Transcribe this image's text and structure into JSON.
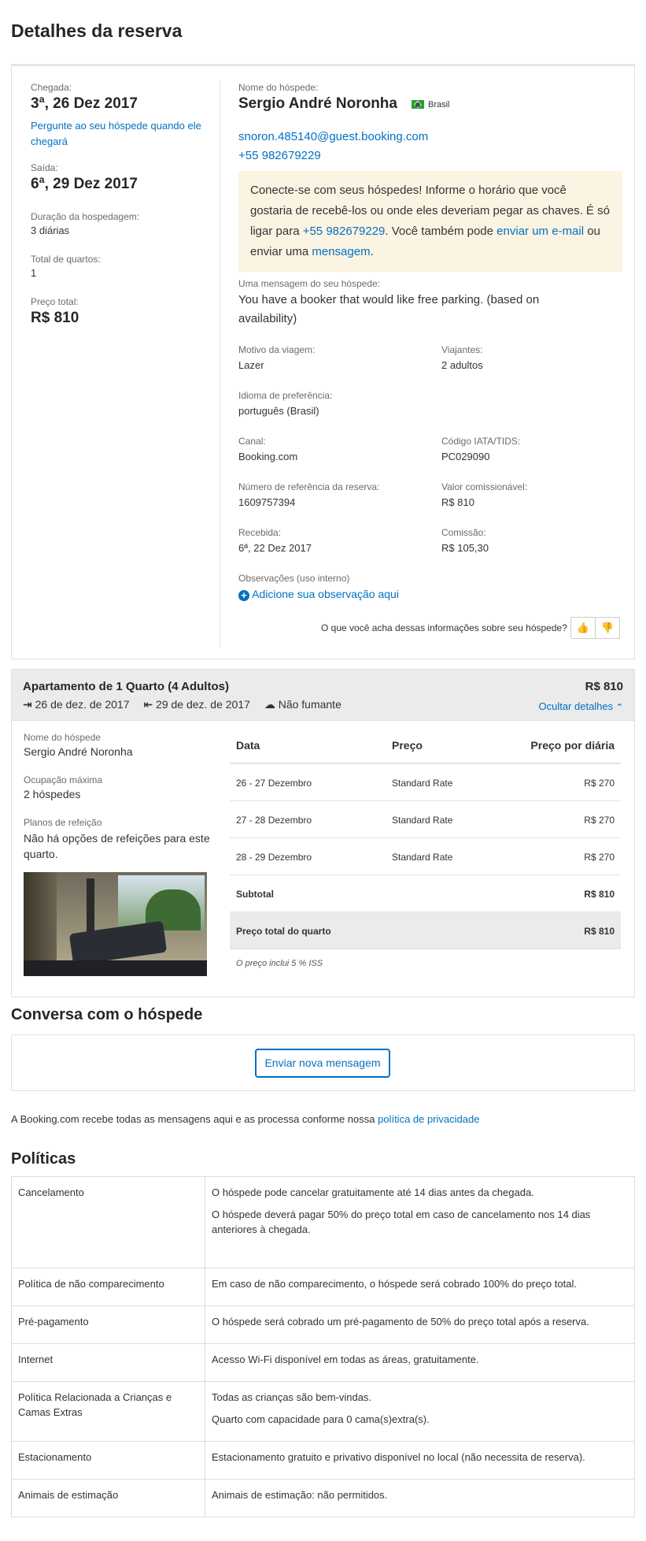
{
  "page_title": "Detalhes da reserva",
  "left": {
    "checkin_label": "Chegada:",
    "checkin_value": "3ª, 26 Dez 2017",
    "ask_link": "Pergunte ao seu hóspede quando ele chegará",
    "checkout_label": "Saída:",
    "checkout_value": "6ª, 29 Dez 2017",
    "stay_label": "Duração da hospedagem:",
    "stay_value": "3 diárias",
    "rooms_label": "Total de quartos:",
    "rooms_value": "1",
    "price_label": "Preço total:",
    "price_value": "R$ 810"
  },
  "guest": {
    "name_label": "Nome do hóspede:",
    "name": "Sergio André Noronha",
    "country": "Brasil",
    "email": "snoron.485140@guest.booking.com",
    "phone": "+55 982679229"
  },
  "notice": {
    "t1": "Conecte-se com seus hóspedes! Informe o horário que você gostaria de recebê-los ou onde eles deveriam pegar as chaves. É só ligar para ",
    "phone": "+55 982679229",
    "t2": ". Você também pode ",
    "email_link": "enviar um e-mail",
    "t3": " ou enviar uma ",
    "msg_link": "mensagem",
    "t4": "."
  },
  "message": {
    "label": "Uma mensagem do seu hóspede:",
    "text": "You have a booker that would like free parking. (based on availability)"
  },
  "details": {
    "motivo_label": "Motivo da viagem:",
    "motivo": "Lazer",
    "viajantes_label": "Viajantes:",
    "viajantes": "2 adultos",
    "idioma_label": "Idioma de preferência:",
    "idioma": "português (Brasil)",
    "canal_label": "Canal:",
    "canal": "Booking.com",
    "iata_label": "Código IATA/TIDS:",
    "iata": "PC029090",
    "ref_label": "Número de referência da reserva:",
    "ref": "1609757394",
    "valor_label": "Valor comissionável:",
    "valor": "R$ 810",
    "recebida_label": "Recebida:",
    "recebida": "6ª, 22 Dez 2017",
    "comissao_label": "Comissão:",
    "comissao": "R$ 105,30",
    "obs_label": "Observações (uso interno)",
    "obs_link": "Adicione sua observação aqui",
    "feedback": "O que você acha dessas informações sobre seu hóspede?"
  },
  "room": {
    "title": "Apartamento de 1 Quarto (4 Adultos)",
    "price": "R$ 810",
    "checkin": "26 de dez. de 2017",
    "checkout": "29 de dez. de 2017",
    "smoking": "Não fumante",
    "hide": "Ocultar detalhes",
    "guest_label": "Nome do hóspede",
    "guest": "Sergio André Noronha",
    "occ_label": "Ocupação máxima",
    "occ": "2 hóspedes",
    "meal_label": "Planos de refeição",
    "meal": "Não há opções de refeições para este quarto.",
    "table": {
      "h_date": "Data",
      "h_price": "Preço",
      "h_daily": "Preço por diária",
      "rows": [
        {
          "date": "26 - 27 Dezembro",
          "rate": "Standard Rate",
          "amount": "R$ 270"
        },
        {
          "date": "27 - 28 Dezembro",
          "rate": "Standard Rate",
          "amount": "R$ 270"
        },
        {
          "date": "28 - 29 Dezembro",
          "rate": "Standard Rate",
          "amount": "R$ 270"
        }
      ],
      "subtotal_label": "Subtotal",
      "subtotal": "R$ 810",
      "total_label": "Preço total do quarto",
      "total": "R$ 810",
      "note": "O preço inclui 5 % ISS"
    }
  },
  "conversation": {
    "title": "Conversa com o hóspede",
    "button": "Enviar nova mensagem",
    "privacy_text": "A Booking.com recebe todas as mensagens aqui e as processa conforme nossa ",
    "privacy_link": "política de privacidade"
  },
  "policies": {
    "title": "Políticas",
    "rows": [
      {
        "k": "Cancelamento",
        "v": [
          "O hóspede pode cancelar gratuitamente até 14 dias antes da chegada.",
          "O hóspede deverá pagar 50% do preço total em caso de cancelamento nos 14 dias anteriores à chegada."
        ]
      },
      {
        "k": "Política de não comparecimento",
        "v": [
          "Em caso de não comparecimento, o hóspede será cobrado 100% do preço total."
        ]
      },
      {
        "k": "Pré-pagamento",
        "v": [
          "O hóspede será cobrado um pré-pagamento de 50% do preço total após a reserva."
        ]
      },
      {
        "k": "Internet",
        "v": [
          "Acesso Wi-Fi disponível em todas as áreas, gratuitamente."
        ]
      },
      {
        "k": "Política Relacionada a Crianças e Camas Extras",
        "v": [
          "Todas as crianças são bem-vindas.",
          "Quarto com capacidade para 0 cama(s)extra(s)."
        ]
      },
      {
        "k": "Estacionamento",
        "v": [
          "Estacionamento gratuito e privativo disponível no local (não necessita de reserva)."
        ]
      },
      {
        "k": "Animais de estimação",
        "v": [
          "Animais de estimação: não permitidos."
        ]
      }
    ]
  },
  "colors": {
    "link": "#0071c2",
    "notice_bg": "#fcf4e2",
    "room_header_bg": "#ebebeb"
  },
  "icons": [
    "brazil-flag-icon",
    "plus-circle-icon",
    "thumbs-up-icon",
    "thumbs-down-icon",
    "checkin-icon",
    "checkout-icon",
    "cloud-icon",
    "chevron-up-icon"
  ]
}
